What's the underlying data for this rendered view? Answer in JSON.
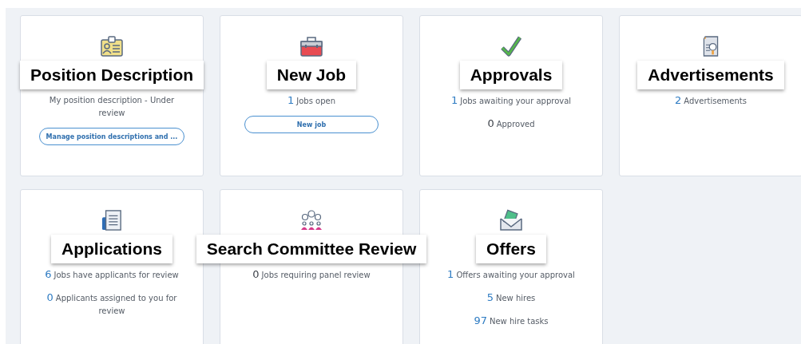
{
  "cards": [
    {
      "kind": "badge",
      "title": "Position Description",
      "lines": [
        {
          "text": "My position description - Under review"
        }
      ],
      "button": "Manage position descriptions and ..."
    },
    {
      "kind": "toolbox",
      "title": "New Job",
      "lines": [
        {
          "number": "1",
          "text": "Jobs open",
          "linked": true
        }
      ],
      "button": "New job"
    },
    {
      "kind": "check",
      "title": "Approvals",
      "lines": [
        {
          "number": "1",
          "text": "Jobs awaiting your approval",
          "linked": true
        },
        {
          "number": "0",
          "text": "Approved",
          "linked": false
        }
      ]
    },
    {
      "kind": "magnifier",
      "title": "Advertisements",
      "lines": [
        {
          "number": "2",
          "text": "Advertisements",
          "linked": true
        }
      ]
    },
    {
      "kind": "document",
      "title": "Applications",
      "lines": [
        {
          "number": "6",
          "text": "Jobs have applicants for review",
          "linked": true
        },
        {
          "number": "0",
          "text": "Applicants assigned to you for review",
          "linked": true
        }
      ]
    },
    {
      "kind": "people",
      "title": "Search Committee Review",
      "lines": [
        {
          "number": "0",
          "text": "Jobs requiring panel review",
          "linked": false
        }
      ]
    },
    {
      "kind": "envelope",
      "title": "Offers",
      "lines": [
        {
          "number": "1",
          "text": "Offers awaiting your approval",
          "linked": true
        },
        {
          "number": "5",
          "text": "New hires",
          "linked": true
        },
        {
          "number": "97",
          "text": "New hire tasks",
          "linked": true
        }
      ]
    }
  ]
}
